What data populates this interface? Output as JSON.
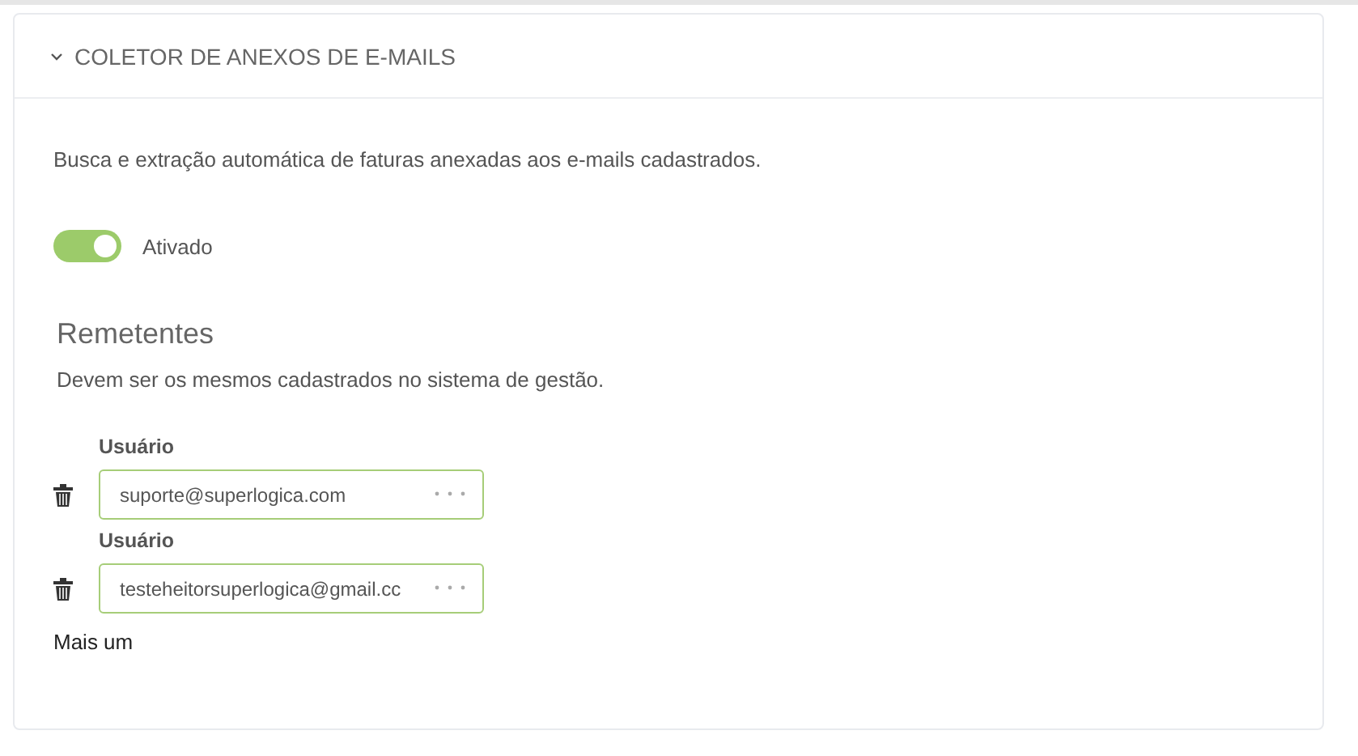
{
  "section": {
    "title": "COLETOR DE ANEXOS DE E-MAILS",
    "expanded": true,
    "description": "Busca e extração automática de faturas anexadas aos e-mails cadastrados.",
    "toggle": {
      "label": "Ativado",
      "on": true
    },
    "senders": {
      "heading": "Remetentes",
      "hint": "Devem ser os mesmos cadastrados no sistema de gestão.",
      "items": [
        {
          "label": "Usuário",
          "value": "suporte@superlogica.com"
        },
        {
          "label": "Usuário",
          "value": "testeheitorsuperlogica@gmail.cc"
        }
      ],
      "add_link": "Mais um"
    }
  }
}
